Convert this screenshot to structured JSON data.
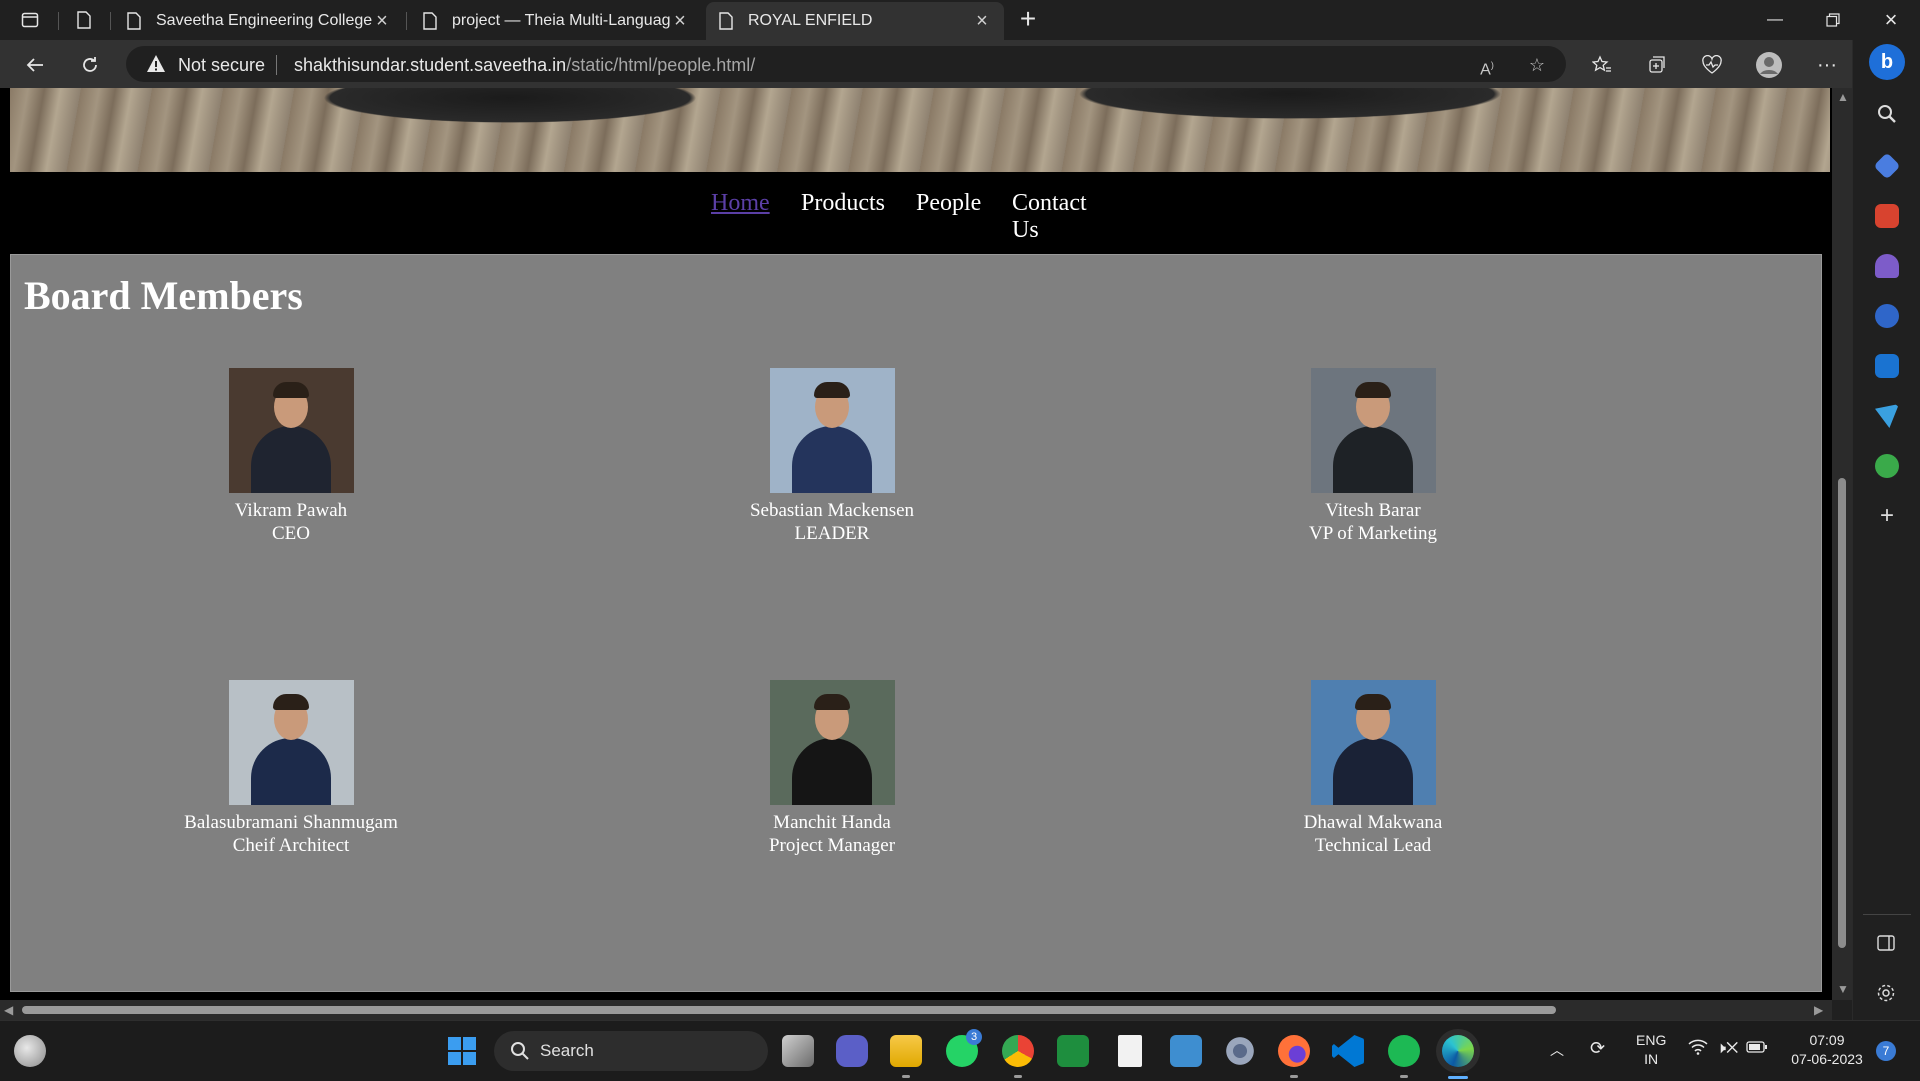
{
  "browser": {
    "tabs": [
      {
        "title": "Saveetha Engineering College",
        "active": false
      },
      {
        "title": "project — Theia Multi-Language",
        "active": false
      },
      {
        "title": "ROYAL ENFIELD",
        "active": true
      }
    ],
    "security_label": "Not secure",
    "url_host": "shakthisundar.student.saveetha.in",
    "url_path": "/static/html/people.html/"
  },
  "site": {
    "nav": [
      {
        "label": "Home",
        "current": true
      },
      {
        "label": "Products",
        "current": false
      },
      {
        "label": "People",
        "current": false
      },
      {
        "label": "Contact Us",
        "current": false
      }
    ],
    "heading": "Board Members",
    "members": [
      {
        "name": "Vikram Pawah",
        "role": "CEO",
        "photo_bg": "#4a3a30",
        "suit": "#1f2430"
      },
      {
        "name": "Sebastian Mackensen",
        "role": "LEADER",
        "photo_bg": "#9fb3c8",
        "suit": "#24345c"
      },
      {
        "name": "Vitesh Barar",
        "role": "VP of Marketing",
        "photo_bg": "#6d757e",
        "suit": "#1e2226"
      },
      {
        "name": "Balasubramani Shanmugam",
        "role": "Cheif Architect",
        "photo_bg": "#b8c0c6",
        "suit": "#1c2a4a"
      },
      {
        "name": "Manchit Handa",
        "role": "Project Manager",
        "photo_bg": "#5a6a5c",
        "suit": "#151515"
      },
      {
        "name": "Dhawal Makwana",
        "role": "Technical Lead",
        "photo_bg": "#4f7fb0",
        "suit": "#1a2236"
      }
    ]
  },
  "taskbar": {
    "search_label": "Search",
    "whatsapp_badge": "3",
    "lang_line1": "ENG",
    "lang_line2": "IN",
    "time": "07:09",
    "date": "07-06-2023",
    "notification_count": "7"
  },
  "colors": {
    "panel": "#808080",
    "nav_link": "#ffffff",
    "nav_visited": "#5b3fa6"
  }
}
